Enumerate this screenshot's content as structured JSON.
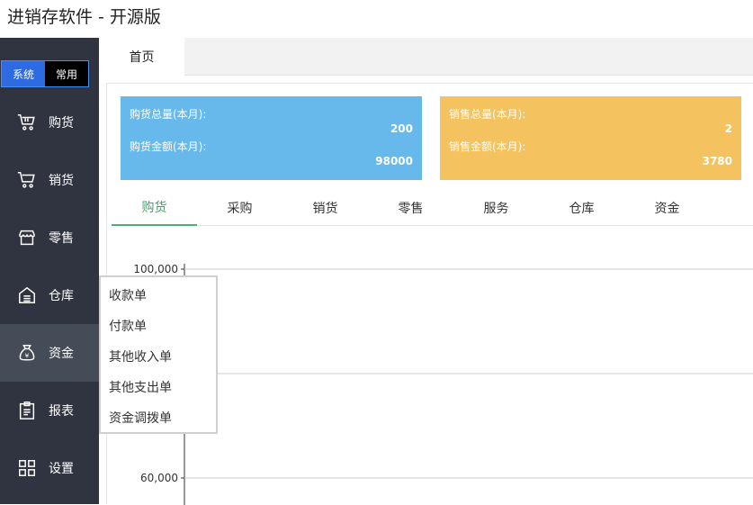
{
  "app": {
    "title": "进销存软件 - 开源版"
  },
  "mode_switch": {
    "system": "系统",
    "common": "常用"
  },
  "sidebar": {
    "items": [
      {
        "label": "购货",
        "icon": "cart-icon"
      },
      {
        "label": "销货",
        "icon": "cart-icon"
      },
      {
        "label": "零售",
        "icon": "store-icon"
      },
      {
        "label": "仓库",
        "icon": "warehouse-icon"
      },
      {
        "label": "资金",
        "icon": "money-bag-icon"
      },
      {
        "label": "报表",
        "icon": "clipboard-icon"
      },
      {
        "label": "设置",
        "icon": "grid-icon"
      }
    ]
  },
  "tabs": {
    "home": "首页"
  },
  "cards": {
    "buy": {
      "total_label": "购货总量(本月):",
      "total_value": "200",
      "amount_label": "购货金额(本月):",
      "amount_value": "98000"
    },
    "sell": {
      "total_label": "销售总量(本月):",
      "total_value": "2",
      "amount_label": "销售金额(本月):",
      "amount_value": "3780"
    }
  },
  "subtabs": [
    "购货",
    "采购",
    "销货",
    "零售",
    "服务",
    "仓库",
    "资金"
  ],
  "chart_data": {
    "type": "line",
    "y_ticks": [
      "100,000",
      "60,000"
    ],
    "ylim": [
      60000,
      100000
    ],
    "grid": true
  },
  "popup_menu": {
    "items": [
      "收款单",
      "付款单",
      "其他收入单",
      "其他支出单",
      "资金调拨单"
    ]
  },
  "colors": {
    "buy_card": "#67b9ec",
    "sell_card": "#f4c25f",
    "sidebar": "#2f3440",
    "accent": "#4cae7a"
  }
}
